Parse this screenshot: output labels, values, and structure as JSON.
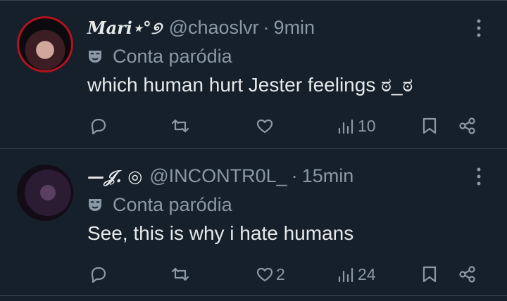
{
  "tweets": [
    {
      "name": "Mari⋆°୭",
      "handle": "@chaoslvr",
      "sep": "·",
      "time": "9min",
      "parody_label": "Conta paródia",
      "text": "which human hurt Jester feelings ಠ_ಠ",
      "views": "10",
      "likes": "",
      "replies": "",
      "retweets": ""
    },
    {
      "name": "—𝒥. ◎",
      "handle": "@INCONTR0L_",
      "sep": "·",
      "time": "15min",
      "parody_label": "Conta paródia",
      "text": "See, this is why i hate humans",
      "views": "24",
      "likes": "2",
      "replies": "",
      "retweets": ""
    }
  ],
  "icons": [
    "reply-icon",
    "retweet-icon",
    "like-icon",
    "views-icon",
    "bookmark-icon",
    "share-icon",
    "more-icon",
    "parody-mask-icon"
  ],
  "colors": {
    "background": "#15202b",
    "text": "#e7e9ea",
    "muted": "#8b98a5",
    "divider": "#38444d"
  }
}
